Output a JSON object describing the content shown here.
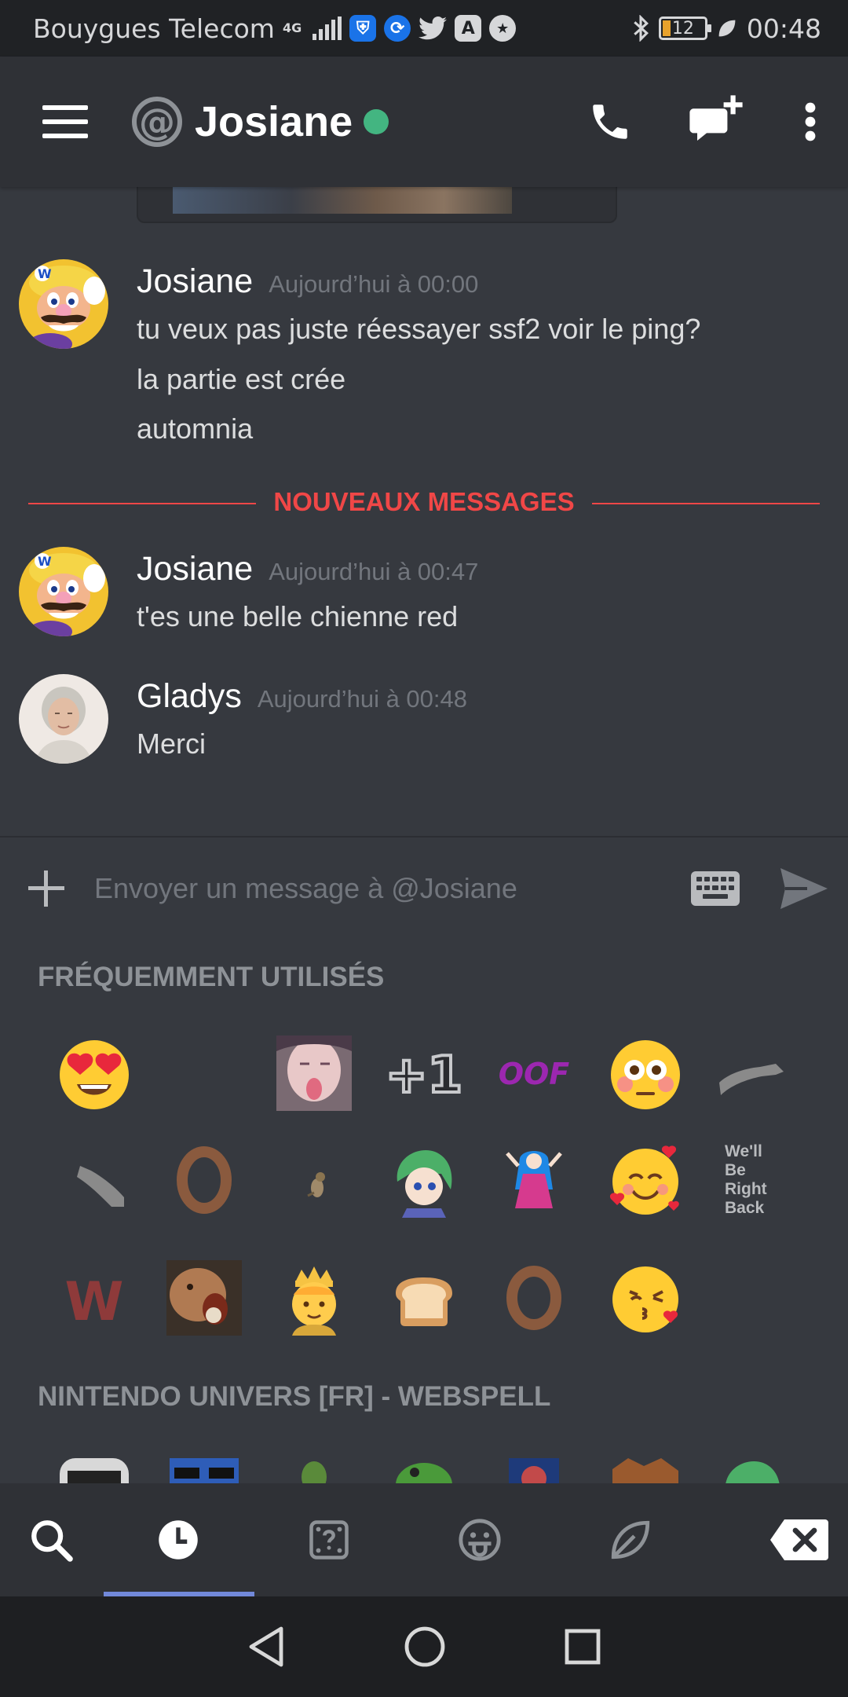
{
  "status_bar": {
    "carrier": "Bouygues Telecom",
    "network": "4G",
    "battery": "12",
    "time": "00:48"
  },
  "header": {
    "channel_prefix": "@",
    "title": "Josiane",
    "status": "online",
    "status_color": "#43b581"
  },
  "messages": [
    {
      "author": "Josiane",
      "timestamp": "Aujourd’hui à 00:00",
      "lines": [
        "tu veux pas juste réessayer ssf2 voir le ping?",
        "la partie est crée",
        "automnia"
      ]
    },
    {
      "author": "Josiane",
      "timestamp": "Aujourd’hui à 00:47",
      "lines": [
        "t'es une belle chienne red"
      ]
    },
    {
      "author": "Gladys",
      "timestamp": "Aujourd’hui à 00:48",
      "lines": [
        "Merci"
      ]
    }
  ],
  "new_messages_label": "NOUVEAUX MESSAGES",
  "input": {
    "placeholder": "Envoyer un message à @Josiane"
  },
  "emoji_panel": {
    "section_frequent": "FRÉQUEMMENT UTILISÉS",
    "section_server": "NINTENDO UNIVERS [FR] - WEBSPELL",
    "emoji_text": {
      "plus_one": "+1",
      "oof": "OOF",
      "brb": "We'll Be Right Back",
      "w": "W"
    }
  },
  "tabs": [
    "search",
    "recent",
    "random",
    "tongue-face",
    "leaf",
    "backspace"
  ],
  "colors": {
    "accent": "#7289da",
    "danger": "#f04747",
    "background": "#36393f",
    "header": "#2f3136"
  }
}
